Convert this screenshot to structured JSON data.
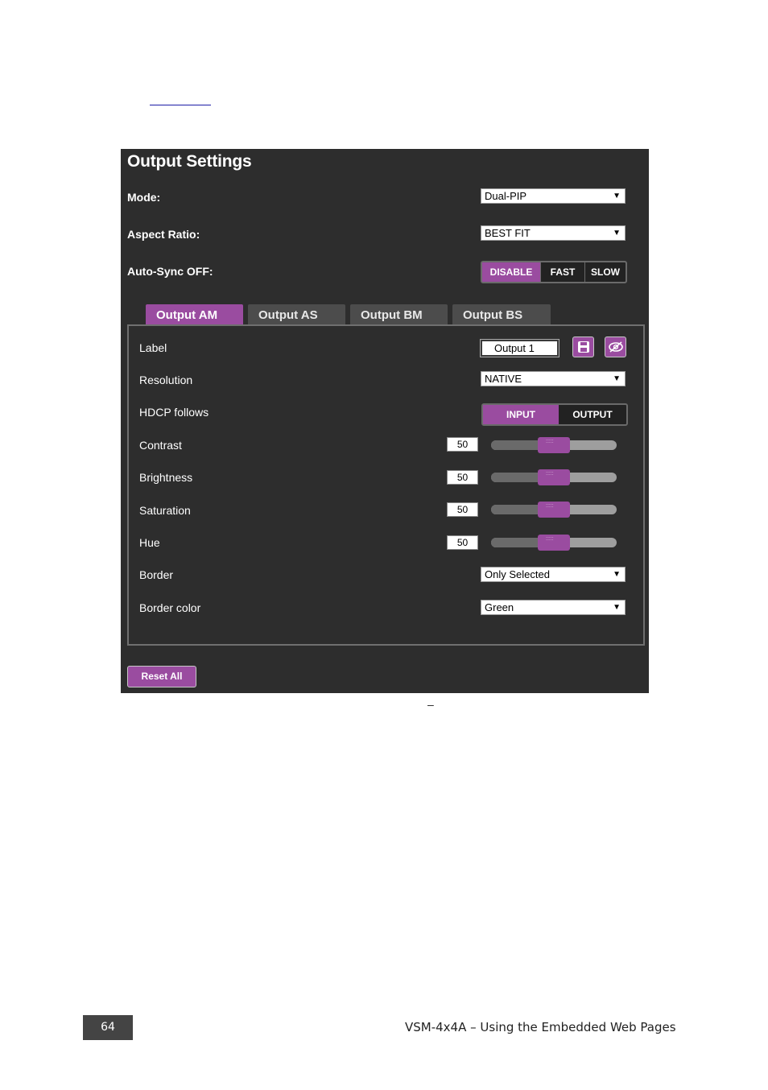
{
  "panel": {
    "title": "Output Settings",
    "mode": {
      "label": "Mode:",
      "value": "Dual-PIP"
    },
    "aspect_ratio": {
      "label": "Aspect Ratio:",
      "value": "BEST FIT"
    },
    "auto_sync": {
      "label": "Auto-Sync OFF:",
      "options": [
        "DISABLE",
        "FAST",
        "SLOW"
      ],
      "selected": "DISABLE"
    },
    "tabs": [
      "Output AM",
      "Output AS",
      "Output BM",
      "Output BS"
    ],
    "active_tab": "Output AM",
    "output": {
      "label": {
        "label": "Label",
        "value": "Output  1"
      },
      "resolution": {
        "label": "Resolution",
        "value": "NATIVE"
      },
      "hdcp": {
        "label": "HDCP follows",
        "options": [
          "INPUT",
          "OUTPUT"
        ],
        "selected": "INPUT"
      },
      "contrast": {
        "label": "Contrast",
        "value": "50"
      },
      "brightness": {
        "label": "Brightness",
        "value": "50"
      },
      "saturation": {
        "label": "Saturation",
        "value": "50"
      },
      "hue": {
        "label": "Hue",
        "value": "50"
      },
      "border": {
        "label": "Border",
        "value": "Only Selected"
      },
      "border_color": {
        "label": "Border color",
        "value": "Green"
      }
    },
    "reset_label": "Reset All"
  },
  "caption": "–",
  "footer": {
    "page_number": "64",
    "text": "VSM-4x4A – Using the Embedded Web Pages"
  },
  "slider_range": [
    0,
    100
  ],
  "colors": {
    "accent": "#9a4ca0",
    "panel_bg": "#2d2d2d"
  },
  "icons": [
    "save-icon",
    "hide-icon",
    "dropdown-arrow-icon"
  ]
}
